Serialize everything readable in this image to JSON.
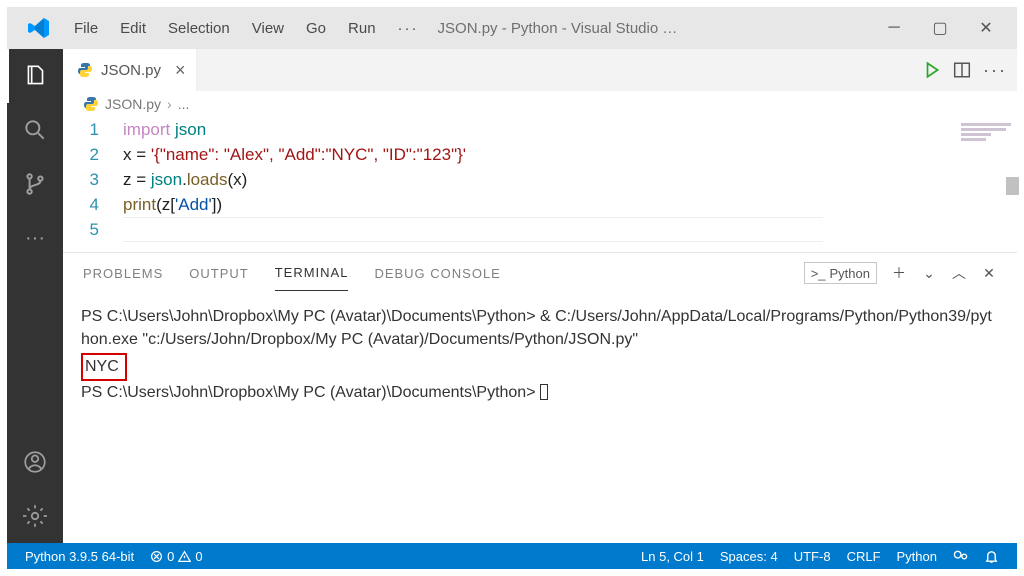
{
  "titlebar": {
    "menu": {
      "file": "File",
      "edit": "Edit",
      "selection": "Selection",
      "view": "View",
      "go": "Go",
      "run": "Run"
    },
    "overflow": "···",
    "title": "JSON.py - Python - Visual Studio …"
  },
  "tabs": {
    "active_file": "JSON.py",
    "close": "×"
  },
  "breadcrumb": {
    "file": "JSON.py",
    "sep": "›",
    "more": "..."
  },
  "editor": {
    "ln1": "1",
    "ln2": "2",
    "ln3": "3",
    "ln4": "4",
    "ln5": "5",
    "t_import": "import",
    "t_json": "json",
    "t_xvar": "x ",
    "t_eq": "= ",
    "t_str_full": "'{\"name\": \"Alex\", \"Add\":\"NYC\", \"ID\":\"123\"}'",
    "t_zvar": "z ",
    "t_loads": "loads",
    "t_dot": ".",
    "t_x": "x",
    "t_print": "print",
    "t_z": "z",
    "t_key": "'Add'",
    "lp": "(",
    "rp": ")",
    "lb": "[",
    "rb": "]"
  },
  "panel": {
    "tabs": {
      "problems": "PROBLEMS",
      "output": "OUTPUT",
      "terminal": "TERMINAL",
      "debug": "DEBUG CONSOLE"
    },
    "repl": "Python"
  },
  "terminal": {
    "line1": "PS C:\\Users\\John\\Dropbox\\My PC (Avatar)\\Documents\\Python> & C:/Users/John/AppData/Local/Programs/Python/Python39/python.exe \"c:/Users/John/Dropbox/My PC (Avatar)/Documents/Python/JSON.py\"",
    "output": "NYC",
    "line3": "PS C:\\Users\\John\\Dropbox\\My PC (Avatar)\\Documents\\Python> "
  },
  "status": {
    "python": "Python 3.9.5 64-bit",
    "err": "0",
    "warn": "0",
    "pos": "Ln 5, Col 1",
    "spaces": "Spaces: 4",
    "enc": "UTF-8",
    "eol": "CRLF",
    "lang": "Python"
  }
}
